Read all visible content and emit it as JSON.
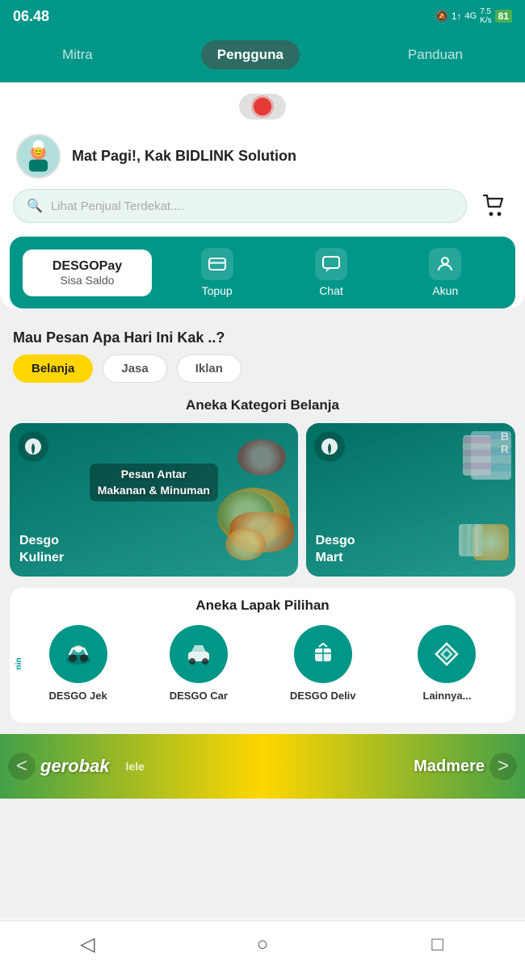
{
  "statusBar": {
    "time": "06.48",
    "icons": "🔕 1l 4G 7.5 K/s",
    "battery": "81"
  },
  "topNav": {
    "tabs": [
      {
        "id": "mitra",
        "label": "Mitra",
        "active": false
      },
      {
        "id": "pengguna",
        "label": "Pengguna",
        "active": true
      },
      {
        "id": "panduan",
        "label": "Panduan",
        "active": false
      }
    ]
  },
  "greeting": {
    "text": "Mat Pagi!,  Kak BIDLINK Solution",
    "avatarEmoji": "🧑‍🍳"
  },
  "searchBar": {
    "placeholder": "Lihat Penjual Terdekat...."
  },
  "desgoPay": {
    "title": "DESGOPay",
    "subtitle": "Sisa Saldo"
  },
  "actionButtons": [
    {
      "id": "topup",
      "label": "Topup",
      "icon": "💳"
    },
    {
      "id": "chat",
      "label": "Chat",
      "icon": "💬"
    },
    {
      "id": "akun",
      "label": "Akun",
      "icon": "👤"
    }
  ],
  "sectionQuestion": "Mau Pesan Apa Hari Ini Kak ..?",
  "categoryTabs": [
    {
      "id": "belanja",
      "label": "Belanja",
      "active": true
    },
    {
      "id": "jasa",
      "label": "Jasa",
      "active": false
    },
    {
      "id": "iklan",
      "label": "Iklan",
      "active": false
    }
  ],
  "belanjaSection": {
    "heading": "Aneka Kategori Belanja",
    "cards": [
      {
        "id": "kuliner",
        "title": "Desgo\nKuliner",
        "banner": "Pesan Antar\nMakanan & Minuman",
        "color": "#006655"
      },
      {
        "id": "mart",
        "title": "Desgo\nMart",
        "color": "#006655"
      }
    ]
  },
  "lapakSection": {
    "heading": "Aneka Lapak Pilihan",
    "items": [
      {
        "id": "jek",
        "label": "DESGO Jek",
        "icon": "🛵"
      },
      {
        "id": "car",
        "label": "DESGO Car",
        "icon": "🚗"
      },
      {
        "id": "deliv",
        "label": "DESGO Deliv",
        "icon": "📦"
      },
      {
        "id": "lainnya",
        "label": "Lainnya...",
        "icon": "✦"
      }
    ]
  },
  "bottomBanner": {
    "leftText": "gerobak",
    "rightText": "Madmere",
    "bgColor": "#FFD600"
  },
  "bottomNav": {
    "buttons": [
      "◁",
      "○",
      "□"
    ]
  }
}
